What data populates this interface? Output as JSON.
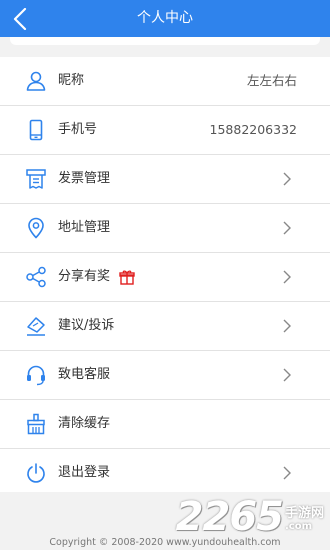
{
  "header": {
    "title": "个人中心",
    "back_icon": "chevron-left-icon"
  },
  "accent_color": "#2f83ec",
  "items": [
    {
      "label": "昵称",
      "value": "左左右右",
      "icon": "user-icon"
    },
    {
      "label": "手机号",
      "value": "15882206332",
      "icon": "phone-icon"
    },
    {
      "label": "发票管理",
      "icon": "invoice-icon"
    },
    {
      "label": "地址管理",
      "icon": "location-icon"
    },
    {
      "label": "分享有奖",
      "icon": "share-icon",
      "badge_icon": "gift-icon"
    },
    {
      "label": "建议/投诉",
      "icon": "feedback-icon"
    },
    {
      "label": "致电客服",
      "icon": "headset-icon"
    },
    {
      "label": "清除缓存",
      "icon": "broom-icon"
    },
    {
      "label": "退出登录",
      "icon": "power-icon"
    }
  ],
  "footer": {
    "copyright": "Copyright © 2008-2020 www.yundouhealth.com",
    "watermark_num": "2265",
    "watermark_cn": "手游网",
    "watermark_domain": ".com"
  }
}
